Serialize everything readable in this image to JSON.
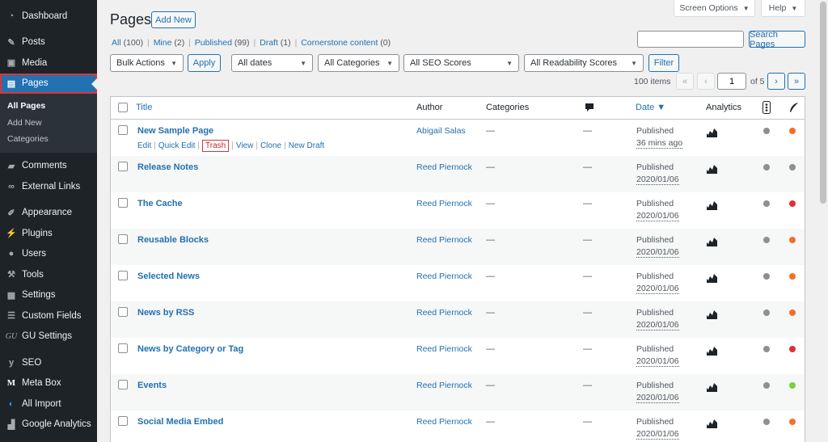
{
  "colors": {
    "sidebar_bg": "#1d2327",
    "accent": "#2271b1",
    "highlight": "#d63638",
    "seo_gray": "#8c8f94",
    "seo_orange": "#f56e28",
    "seo_red": "#dc3232",
    "seo_green": "#7ad03a"
  },
  "sidebar": {
    "items_top": [
      {
        "label": "Dashboard",
        "icon": "dashboard-icon"
      },
      {
        "label": "Posts",
        "icon": "pin-icon"
      },
      {
        "label": "Media",
        "icon": "media-icon"
      },
      {
        "label": "Pages",
        "icon": "pages-icon"
      }
    ],
    "submenu": [
      "All Pages",
      "Add New",
      "Categories"
    ],
    "items_mid": [
      {
        "label": "Comments",
        "icon": "comment-icon"
      },
      {
        "label": "External Links",
        "icon": "link-icon"
      }
    ],
    "items_bottom": [
      {
        "label": "Appearance",
        "icon": "brush-icon"
      },
      {
        "label": "Plugins",
        "icon": "plugin-icon"
      },
      {
        "label": "Users",
        "icon": "users-icon"
      },
      {
        "label": "Tools",
        "icon": "wrench-icon"
      },
      {
        "label": "Settings",
        "icon": "settings-icon"
      },
      {
        "label": "Custom Fields",
        "icon": "fields-icon"
      },
      {
        "label": "GU Settings",
        "icon": "gu-icon"
      }
    ],
    "items_plugins": [
      {
        "label": "SEO",
        "icon": "yoast-icon"
      },
      {
        "label": "Meta Box",
        "icon": "metabox-icon"
      },
      {
        "label": "All Import",
        "icon": "import-icon"
      },
      {
        "label": "Google Analytics",
        "icon": "analytics-icon"
      }
    ]
  },
  "header": {
    "title": "Pages",
    "add_new": "Add New",
    "screen_options": "Screen Options",
    "help": "Help"
  },
  "filters": {
    "all": "All",
    "all_count": "(100)",
    "mine": "Mine",
    "mine_count": "(2)",
    "published": "Published",
    "published_count": "(99)",
    "draft": "Draft",
    "draft_count": "(1)",
    "cornerstone": "Cornerstone content",
    "cornerstone_count": "(0)"
  },
  "search": {
    "value": "",
    "button": "Search Pages"
  },
  "toolbar": {
    "bulk_actions": "Bulk Actions",
    "apply": "Apply",
    "dates": "All dates",
    "categories": "All Categories",
    "seo": "All SEO Scores",
    "readability": "All Readability Scores",
    "filter": "Filter"
  },
  "pagination": {
    "items": "100 items",
    "first": "«",
    "prev": "‹",
    "current": "1",
    "of": "of 5",
    "next": "›",
    "last": "»"
  },
  "table": {
    "columns": {
      "title": "Title",
      "author": "Author",
      "categories": "Categories",
      "date": "Date ▼",
      "analytics": "Analytics"
    },
    "row_actions": {
      "edit": "Edit",
      "quick_edit": "Quick Edit",
      "trash": "Trash",
      "view": "View",
      "clone": "Clone",
      "new_draft": "New Draft"
    },
    "rows": [
      {
        "title": "New Sample Page",
        "author": "Abigail Salas",
        "categories": "—",
        "comments": "—",
        "status": "Published",
        "date": "36 mins ago",
        "seo": "gray",
        "readability": "orange"
      },
      {
        "title": "Release Notes",
        "author": "Reed Piernock",
        "categories": "—",
        "comments": "—",
        "status": "Published",
        "date": "2020/01/06",
        "seo": "gray",
        "readability": "gray"
      },
      {
        "title": "The Cache",
        "author": "Reed Piernock",
        "categories": "—",
        "comments": "—",
        "status": "Published",
        "date": "2020/01/06",
        "seo": "gray",
        "readability": "red"
      },
      {
        "title": "Reusable Blocks",
        "author": "Reed Piernock",
        "categories": "—",
        "comments": "—",
        "status": "Published",
        "date": "2020/01/06",
        "seo": "gray",
        "readability": "orange"
      },
      {
        "title": "Selected News",
        "author": "Reed Piernock",
        "categories": "—",
        "comments": "—",
        "status": "Published",
        "date": "2020/01/06",
        "seo": "gray",
        "readability": "orange"
      },
      {
        "title": "News by RSS",
        "author": "Reed Piernock",
        "categories": "—",
        "comments": "—",
        "status": "Published",
        "date": "2020/01/06",
        "seo": "gray",
        "readability": "orange"
      },
      {
        "title": "News by Category or Tag",
        "author": "Reed Piernock",
        "categories": "—",
        "comments": "—",
        "status": "Published",
        "date": "2020/01/06",
        "seo": "gray",
        "readability": "red"
      },
      {
        "title": "Events",
        "author": "Reed Piernock",
        "categories": "—",
        "comments": "—",
        "status": "Published",
        "date": "2020/01/06",
        "seo": "gray",
        "readability": "green"
      },
      {
        "title": "Social Media Embed",
        "author": "Reed Piernock",
        "categories": "—",
        "comments": "—",
        "status": "Published",
        "date": "2020/01/06",
        "seo": "gray",
        "readability": "orange"
      }
    ]
  }
}
